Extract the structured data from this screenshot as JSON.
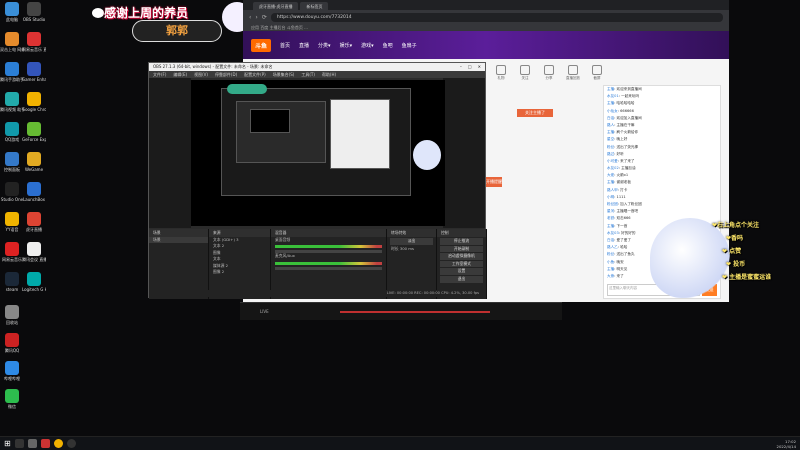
{
  "desktop": {
    "icons": [
      {
        "label": "此电脑",
        "color": "#3a8fd8"
      },
      {
        "label": "OBS Studio",
        "color": "#444"
      },
      {
        "label": "双击上电 网络发现",
        "color": "#e58b2c"
      },
      {
        "label": "网易云音乐 直播助手",
        "color": "#d33"
      },
      {
        "label": "腾讯手游助手",
        "color": "#2b7fd6"
      },
      {
        "label": "Gamer Enhancer",
        "color": "#35b"
      },
      {
        "label": "腾讯视频 助手",
        "color": "#2aa"
      },
      {
        "label": "Google Chrome",
        "color": "#f2b200"
      },
      {
        "label": "QQ游戏",
        "color": "#19a"
      },
      {
        "label": "GeForce Experience",
        "color": "#6b3"
      },
      {
        "label": "控制面板",
        "color": "#3479c9"
      },
      {
        "label": "WeGame",
        "color": "#e2aa22"
      },
      {
        "label": "Studio One",
        "color": "#222"
      },
      {
        "label": "LaunchBox",
        "color": "#2b6fd0"
      },
      {
        "label": "YY语音",
        "color": "#f0b400"
      },
      {
        "label": "虎牙直播",
        "color": "#d43"
      },
      {
        "label": "网易云音乐",
        "color": "#d22"
      },
      {
        "label": "腾讯会议 直播伴侣",
        "color": "#eee"
      },
      {
        "label": "steam",
        "color": "#1b2838"
      },
      {
        "label": "Logitech G HUB",
        "color": "#0aa"
      },
      {
        "label": "回收站",
        "color": "#888"
      },
      {
        "label": "腾讯QQ",
        "color": "#c22"
      },
      {
        "label": "哔哩哔哩",
        "color": "#2e8ae6"
      },
      {
        "label": "微信",
        "color": "#2dbd4e"
      }
    ]
  },
  "overlay": {
    "thanks_text": "感谢上周的养员",
    "name_text": "郭郭",
    "follow_lines": [
      "❤右上角点个关注",
      "❤香吗",
      "❤ 点赞",
      "❤ 投币",
      "❤ 主播是蜜蜜运谁"
    ]
  },
  "browser": {
    "tabs": [
      "虎牙直播-虎牙直播",
      "新标签页"
    ],
    "url": "https://www.douyu.com/7732014",
    "bookmarks": "应用  百度  主播后台  斗鱼首页  ...",
    "site_logo": "斗鱼",
    "nav": [
      "首页",
      "直播",
      "分类▾",
      "娱乐▾",
      "游戏▾",
      "鱼吧",
      "鱼吧",
      "鱼扇子"
    ],
    "room_icons": [
      "礼物",
      "关注",
      "分享",
      "直播回放",
      "截屏",
      "投屏"
    ],
    "chat_lines": [
      {
        "user": "主播",
        "text": "欢迎来到直播间"
      },
      {
        "user": "水友01",
        "text": "一起来玩吗"
      },
      {
        "user": "主播",
        "text": "哈哈哈哈哈"
      },
      {
        "user": "小仙女",
        "text": "666666"
      },
      {
        "user": "白话",
        "text": "欢迎加入直播间"
      },
      {
        "user": "路人",
        "text": "主播在干嘛"
      },
      {
        "user": "主播",
        "text": "刷个火箭给你"
      },
      {
        "user": "星空",
        "text": "晚上好"
      },
      {
        "user": "粉丝",
        "text": "送出了荧光棒"
      },
      {
        "user": "路过",
        "text": "好听"
      },
      {
        "user": "小可爱",
        "text": "来了来了"
      },
      {
        "user": "水友02",
        "text": "主播加油"
      },
      {
        "user": "大佬",
        "text": "火箭x1"
      },
      {
        "user": "主播",
        "text": "谢谢老板"
      },
      {
        "user": "路人甲",
        "text": "打卡"
      },
      {
        "user": "小明",
        "text": "1111"
      },
      {
        "user": "粉丝团",
        "text": "加入了粉丝团"
      },
      {
        "user": "星河",
        "text": "主播唱一首吧"
      },
      {
        "user": "老铁",
        "text": "双击666"
      },
      {
        "user": "主播",
        "text": "下一首"
      },
      {
        "user": "水友03",
        "text": "好的好的"
      },
      {
        "user": "白话",
        "text": "爱了爱了"
      },
      {
        "user": "路人乙",
        "text": "哈哈"
      },
      {
        "user": "粉丝",
        "text": "送出了鱼丸"
      },
      {
        "user": "小鱼",
        "text": "晚安"
      },
      {
        "user": "主播",
        "text": "明天见"
      },
      {
        "user": "大熊",
        "text": "来了"
      }
    ],
    "chat_input_placeholder": "这里输入聊天内容",
    "send_label": "发送",
    "orange_buttons": [
      "关注主播了",
      "开播提醒"
    ]
  },
  "obs": {
    "title": "OBS 27.1.3 (64-bit, windows) - 配置文件: 未命名 - 场景: 未命名",
    "menu": [
      "文件(F)",
      "编辑(E)",
      "视图(V)",
      "停靠部件(D)",
      "配置文件(P)",
      "场景集合(S)",
      "工具(T)",
      "帮助(H)"
    ],
    "docks": {
      "scenes": {
        "title": "场景",
        "items": [
          "场景"
        ]
      },
      "sources": {
        "title": "来源",
        "items": [
          "文本 (GDI+) 3",
          "文本 2",
          "图像",
          "文本",
          "媒体源 2",
          "图像 2"
        ]
      },
      "mixer": {
        "title": "混音器",
        "tracks": [
          "桌面音频",
          "麦克风/Aux"
        ]
      },
      "transitions": {
        "title": "转场特效",
        "type": "淡出",
        "duration_label": "时长",
        "duration": "300 ms"
      },
      "controls": {
        "title": "控制",
        "buttons": [
          "停止推流",
          "开始录制",
          "启动虚拟摄像机",
          "工作室模式",
          "设置",
          "退出"
        ]
      }
    },
    "status": "LIVE: 00:00:00   REC: 00:00:00   CPU: 4.2%, 30.00 fps"
  },
  "player": {
    "label": "LIVE"
  },
  "taskbar": {
    "time": "17:02",
    "date": "2022/4/14"
  }
}
